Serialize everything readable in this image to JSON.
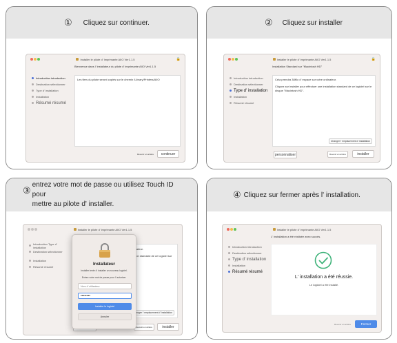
{
  "cards": [
    {
      "number": "①",
      "caption": "Cliquez sur continuer.",
      "window": {
        "title": "Installer le pilote d' Imprimante AIIO Ver1.1.5",
        "subtitle": "Bienvenue dans l' installateur du pilote d' imprimante AIIO Ver1.1.5",
        "steps": [
          "Introduction introduction",
          "Destination sélectionner",
          "Type d' installation",
          "Installation",
          "Résumé résumé"
        ],
        "body": "Les fiers du pilote seront copiés sur le chemin /Library/Printers/AIIO",
        "buttons": [
          "Revenir en arrière",
          "continuer"
        ]
      }
    },
    {
      "number": "②",
      "caption": "Cliquez sur installer",
      "window": {
        "title": "Installer le pilote d' imprimante AIIO Ver1.1.5",
        "subtitle": "Installation Standard sur \"Macintosh HD\"",
        "steps": [
          "Introduction introduction",
          "Destination sélectionner",
          "Type d' installation",
          "Installation",
          "Résumé résumé"
        ],
        "body_lines": [
          "Cela prendra 38Mo d' espace sur votre ordinateur.",
          "Cliquez sur installer pour effectuer une installation standard de ce logiciel sur le disque \"Macintosh HD\"."
        ],
        "change_location": "Changer l' emplacement d' installation",
        "left_button": "personnaliser",
        "buttons": [
          "Revenir en arrière",
          "installer"
        ]
      }
    },
    {
      "number": "③",
      "caption_line1": "entrez votre mot de passe ou utilisez Touch ID pour",
      "caption_line2": "mettre au pilote d' installer.",
      "window": {
        "title": "Installer le pilote d' imprimante AIIO Ver1.1.5",
        "subtitle": "Installation Standard sur \"Macintosh HD\"",
        "steps": [
          "Introduction Type d' installation",
          "Destination sélectionner",
          "Installation",
          "Résumé résumé"
        ],
        "side_text_1": "ordinateur.",
        "side_text_2": "allation standard de ce logiciel sur",
        "change_location": "Changer l' emplacement d' installation",
        "left_button": "personnaliser",
        "buttons": [
          "Revenir en arrière",
          "installer"
        ],
        "dialog": {
          "title": "Installateur",
          "desc": "Installer tente d' installer un nouveau logiciel.",
          "prompt": "Entrez votre mot de passe pour l' autoriser.",
          "username_placeholder": "Nom d' utilisateur",
          "password_value": "••••••••",
          "install_button": "Installer le logiciel",
          "cancel_button": "Annuler"
        }
      }
    },
    {
      "number": "④",
      "caption": "Cliquez sur fermer après l' installation.",
      "window": {
        "title": "Installer le pilote d' imprimante AIIO Ver1.1.5",
        "subtitle": "L' installation a été réalisée avec succès.",
        "steps": [
          "Introduction introduction",
          "Destination sélectionner",
          "Type d' installation",
          "Installation",
          "Résumé résumé"
        ],
        "success_title": "L' installation a été réussie.",
        "success_sub": "Le logiciel a été installé.",
        "buttons": [
          "Revenir en arrière",
          "Fermer"
        ]
      }
    }
  ],
  "colors": {
    "accent": "#4f8be8",
    "success": "#3fb37a",
    "active_step": "#4a6fd6"
  }
}
